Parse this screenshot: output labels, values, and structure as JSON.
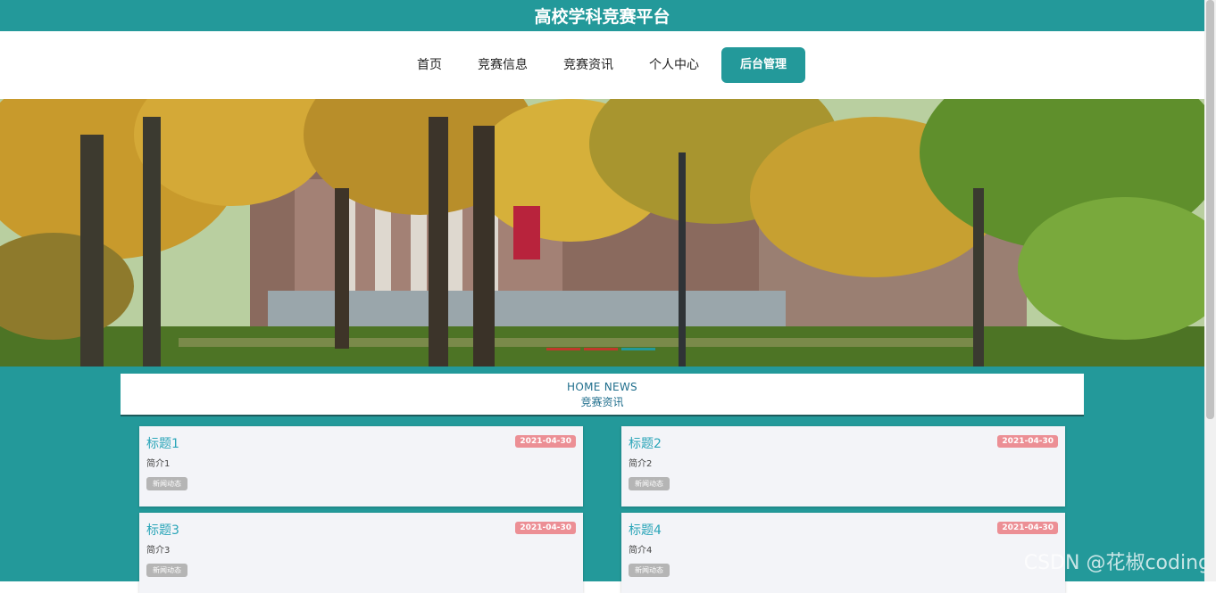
{
  "header": {
    "title": "高校学科竞赛平台"
  },
  "nav": {
    "items": [
      "首页",
      "竞赛信息",
      "竞赛资讯",
      "个人中心"
    ],
    "admin": "后台管理"
  },
  "section": {
    "en": "HOME NEWS",
    "cn": "竞赛资讯"
  },
  "news": [
    {
      "title": "标题1",
      "date": "2021-04-30",
      "desc": "简介1",
      "tag": "新闻动态"
    },
    {
      "title": "标题2",
      "date": "2021-04-30",
      "desc": "简介2",
      "tag": "新闻动态"
    },
    {
      "title": "标题3",
      "date": "2021-04-30",
      "desc": "简介3",
      "tag": "新闻动态"
    },
    {
      "title": "标题4",
      "date": "2021-04-30",
      "desc": "简介4",
      "tag": "新闻动态"
    }
  ],
  "watermark": "CSDN @花椒coding",
  "colors": {
    "accent": "#23999a",
    "date_badge": "#ec8f95",
    "tag": "#b5b5b5"
  }
}
